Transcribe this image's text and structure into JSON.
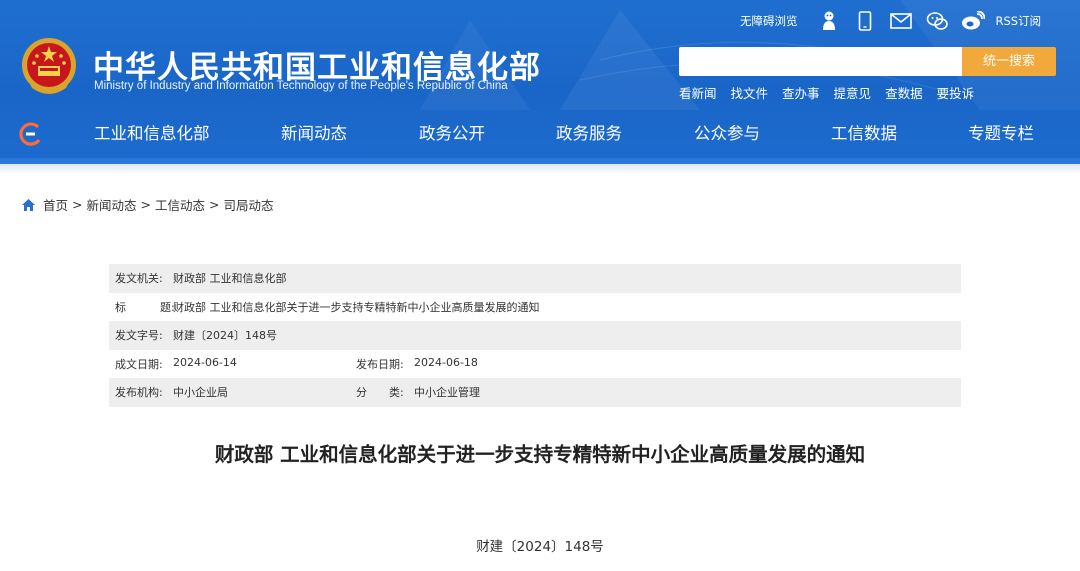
{
  "header": {
    "site_title": "中华人民共和国工业和信息化部",
    "site_subtitle": "Ministry of Industry and Information Technology of the People's Republic of China",
    "tools": {
      "accessibility": "无障碍浏览",
      "rss": "RSS订阅"
    },
    "search": {
      "placeholder": "",
      "button": "统一搜索"
    },
    "quick_links": [
      "看新闻",
      "找文件",
      "查办事",
      "提意见",
      "查数据",
      "要投诉"
    ],
    "nav": [
      "工业和信息化部",
      "新闻动态",
      "政务公开",
      "政务服务",
      "公众参与",
      "工信数据",
      "专题专栏"
    ]
  },
  "breadcrumb": [
    "首页",
    "新闻动态",
    "工信动态",
    "司局动态"
  ],
  "meta": {
    "issuer_label": "发文机关:",
    "issuer": "财政部 工业和信息化部",
    "title_label_a": "标",
    "title_label_b": "题:",
    "title": "财政部 工业和信息化部关于进一步支持专精特新中小企业高质量发展的通知",
    "doc_no_label": "发文字号:",
    "doc_no": "财建〔2024〕148号",
    "date_label": "成文日期:",
    "date": "2024-06-14",
    "pub_date_label": "发布日期:",
    "pub_date": "2024-06-18",
    "org_label": "发布机构:",
    "org": "中小企业局",
    "category_label_a": "分",
    "category_label_b": "类:",
    "category": "中小企业管理"
  },
  "document": {
    "title": "财政部 工业和信息化部关于进一步支持专精特新中小企业高质量发展的通知",
    "number": "财建〔2024〕148号"
  },
  "colors": {
    "header_blue": "#1a66c8",
    "search_button": "#f2a93b",
    "meta_shade": "#eeeeee"
  }
}
